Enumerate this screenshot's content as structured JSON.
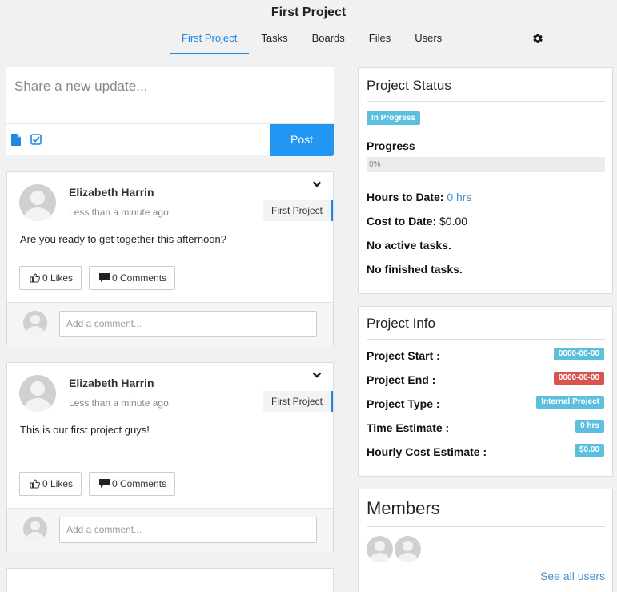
{
  "header": {
    "title": "First Project",
    "tabs": [
      "First Project",
      "Tasks",
      "Boards",
      "Files",
      "Users"
    ],
    "active_tab": "First Project"
  },
  "composer": {
    "placeholder": "Share a new update...",
    "post_label": "Post"
  },
  "posts": [
    {
      "author": "Elizabeth Harrin",
      "time": "Less than a minute ago",
      "project": "First Project",
      "text": "Are you ready to get together this afternoon?",
      "likes_label": "0 Likes",
      "comments_label": "0 Comments",
      "comment_placeholder": "Add a comment..."
    },
    {
      "author": "Elizabeth Harrin",
      "time": "Less than a minute ago",
      "project": "First Project",
      "text": "This is our first project guys!",
      "likes_label": "0 Likes",
      "comments_label": "0 Comments",
      "comment_placeholder": "Add a comment..."
    }
  ],
  "status": {
    "title": "Project Status",
    "badge": "In Progress",
    "progress_label": "Progress",
    "progress_text": "0%",
    "progress_value": 0,
    "hours_label": "Hours to Date:",
    "hours_value": "0 hrs",
    "cost_label": "Cost to Date:",
    "cost_value": "$0.00",
    "active_tasks": "No active tasks.",
    "finished_tasks": "No finished tasks."
  },
  "info": {
    "title": "Project Info",
    "rows": [
      {
        "label": "Project Start :",
        "value": "0000-00-00",
        "color": "#5bc0de"
      },
      {
        "label": "Project End :",
        "value": "0000-00-00",
        "color": "#d9534f"
      },
      {
        "label": "Project Type :",
        "value": "Internal Project",
        "color": "#5bc0de"
      },
      {
        "label": "Time Estimate :",
        "value": "0 hrs",
        "color": "#5bc0de"
      },
      {
        "label": "Hourly Cost Estimate :",
        "value": "$0.00",
        "color": "#5bc0de"
      }
    ]
  },
  "members": {
    "title": "Members",
    "see_all": "See all users"
  },
  "colors": {
    "accent": "#2196f3",
    "info_badge": "#5bc0de",
    "danger_badge": "#d9534f"
  },
  "icons": {
    "settings": "gear-icon",
    "attach": "file-icon",
    "task": "check-square-icon",
    "like": "thumbs-up-icon",
    "comment": "speech-bubble-icon",
    "expand": "chevron-down-icon"
  }
}
